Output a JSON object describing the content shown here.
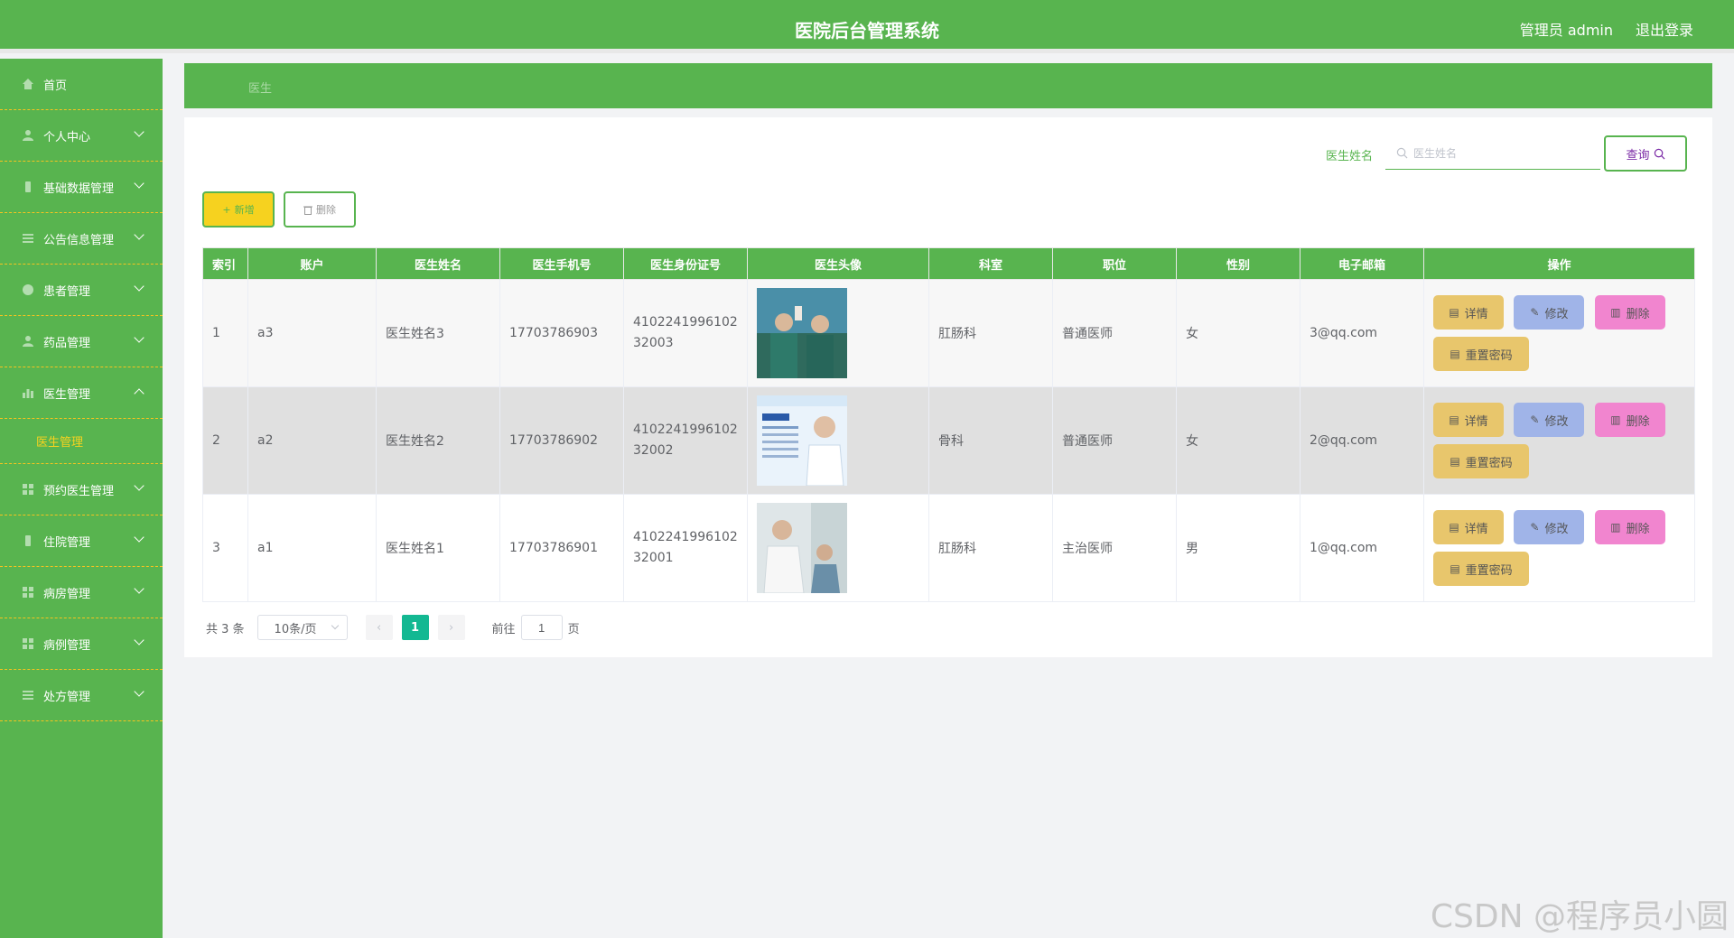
{
  "header": {
    "title": "医院后台管理系统",
    "user": "管理员 admin",
    "logout": "退出登录"
  },
  "sidebar": {
    "items": [
      {
        "label": "首页"
      },
      {
        "label": "个人中心"
      },
      {
        "label": "基础数据管理"
      },
      {
        "label": "公告信息管理"
      },
      {
        "label": "患者管理"
      },
      {
        "label": "药品管理"
      },
      {
        "label": "医生管理"
      },
      {
        "label": "预约医生管理"
      },
      {
        "label": "住院管理"
      },
      {
        "label": "病房管理"
      },
      {
        "label": "病例管理"
      },
      {
        "label": "处方管理"
      }
    ],
    "submenu": {
      "label": "医生管理"
    }
  },
  "breadcrumb": {
    "current": "医生"
  },
  "search": {
    "label": "医生姓名",
    "placeholder": "医生姓名",
    "button": "查询"
  },
  "toolbar": {
    "add": "新增",
    "delete": "删除"
  },
  "table": {
    "headers": [
      "索引",
      "账户",
      "医生姓名",
      "医生手机号",
      "医生身份证号",
      "医生头像",
      "科室",
      "职位",
      "性别",
      "电子邮箱",
      "操作"
    ],
    "rows": [
      {
        "index": "1",
        "account": "a3",
        "name": "医生姓名3",
        "phone": "17703786903",
        "idcard": "410224199610232003",
        "dept": "肛肠科",
        "position": "普通医师",
        "gender": "女",
        "email": "3@qq.com"
      },
      {
        "index": "2",
        "account": "a2",
        "name": "医生姓名2",
        "phone": "17703786902",
        "idcard": "410224199610232002",
        "dept": "骨科",
        "position": "普通医师",
        "gender": "女",
        "email": "2@qq.com"
      },
      {
        "index": "3",
        "account": "a1",
        "name": "医生姓名1",
        "phone": "17703786901",
        "idcard": "410224199610232001",
        "dept": "肛肠科",
        "position": "主治医师",
        "gender": "男",
        "email": "1@qq.com"
      }
    ],
    "actions": {
      "detail": "详情",
      "edit": "修改",
      "delete": "删除",
      "reset": "重置密码"
    }
  },
  "pagination": {
    "total": "共 3 条",
    "page_size": "10条/页",
    "current_page": "1",
    "goto_prefix": "前往",
    "goto_value": "1",
    "goto_suffix": "页"
  },
  "watermark": "CSDN @程序员小圆",
  "colors": {
    "primary": "#58b44f",
    "accent": "#f6d21f",
    "page_active": "#13b892"
  }
}
